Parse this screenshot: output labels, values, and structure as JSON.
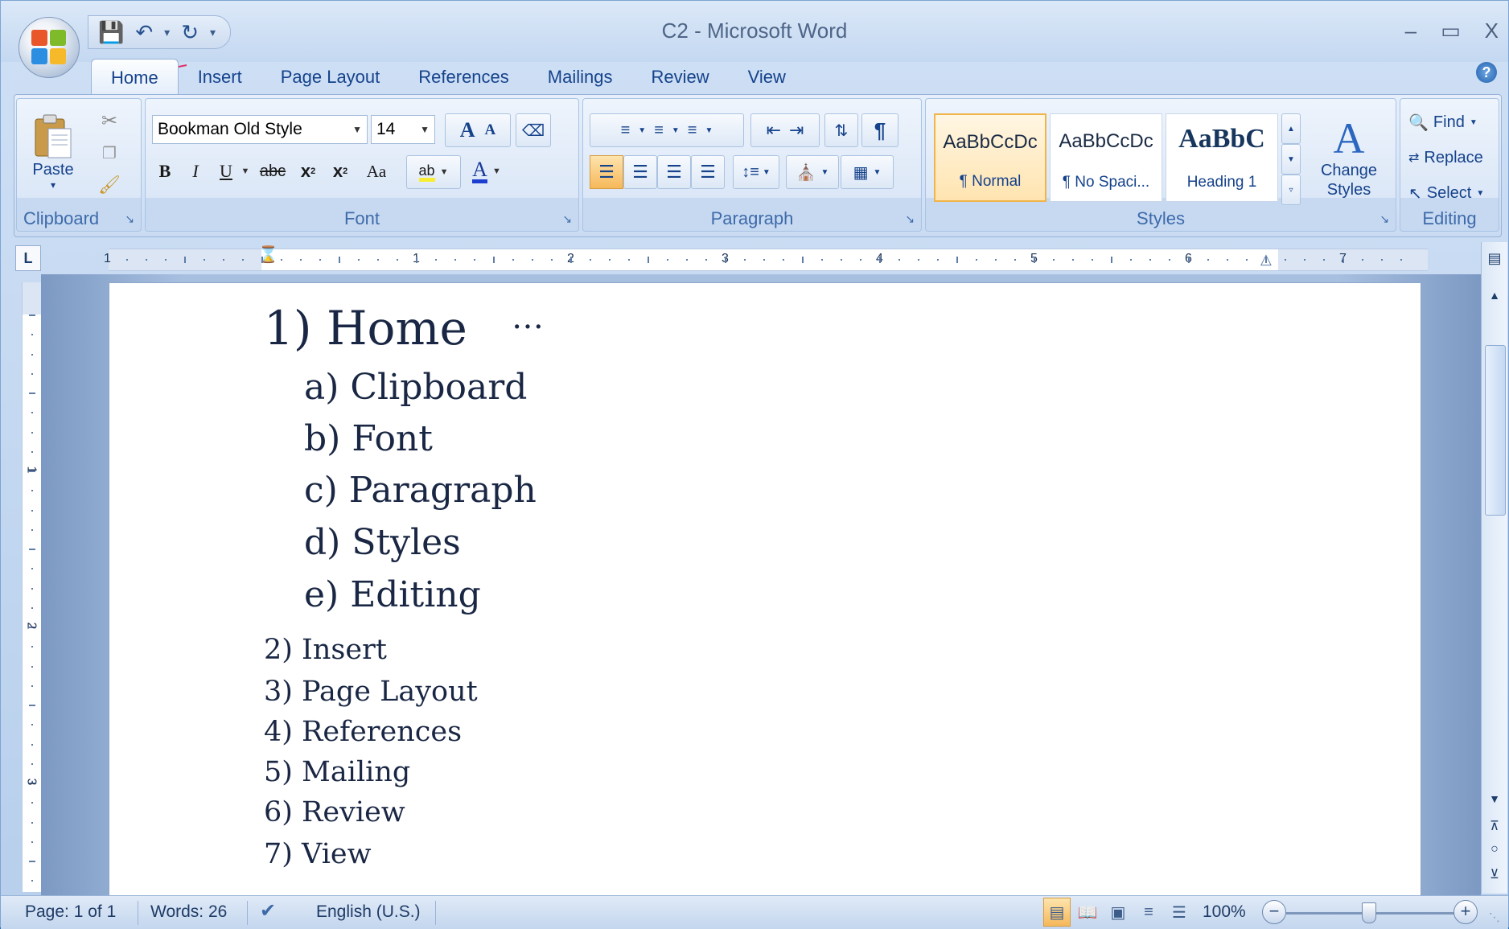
{
  "window": {
    "title": "C2 - Microsoft Word",
    "controls": [
      "–",
      "▭",
      "X"
    ]
  },
  "tabs": [
    "Home",
    "Insert",
    "Page Layout",
    "References",
    "Mailings",
    "Review",
    "View"
  ],
  "clipboard": {
    "paste_label": "Paste",
    "group_label": "Clipboard"
  },
  "font": {
    "name": "Bookman Old Style",
    "size": "14",
    "grow": "A",
    "shrink": "A",
    "bold": "B",
    "italic": "I",
    "underline": "U",
    "strike": "abc",
    "sub": "x",
    "sup": "x",
    "case": "Aa",
    "group_label": "Font"
  },
  "paragraph": {
    "group_label": "Paragraph",
    "pilcrow": "¶"
  },
  "styles": {
    "group_label": "Styles",
    "cards": [
      {
        "preview": "AaBbCcDc",
        "name": "¶ Normal"
      },
      {
        "preview": "AaBbCcDc",
        "name": "¶ No Spaci..."
      },
      {
        "preview": "AaBbC",
        "name": "Heading 1"
      }
    ],
    "change_label": "Change Styles"
  },
  "editing": {
    "find": "Find",
    "replace": "Replace",
    "select": "Select",
    "group_label": "Editing"
  },
  "ruler": {
    "numbers": [
      "1",
      "1",
      "2",
      "3",
      "4",
      "5",
      "6",
      "7"
    ],
    "vnumbers": [
      "1",
      "2",
      "3"
    ],
    "corner": "L"
  },
  "document": {
    "heading": "1)  Home",
    "ellipsis": "…",
    "subitems": [
      "a) Clipboard",
      "b) Font",
      "c) Paragraph",
      "d) Styles",
      "e) Editing"
    ],
    "items": [
      "2) Insert",
      "3) Page Layout",
      "4) References",
      "5) Mailing",
      "6) Review",
      "7) View"
    ]
  },
  "status": {
    "page": "Page: 1 of 1",
    "words": "Words: 26",
    "language": "English (U.S.)",
    "zoom": "100%"
  },
  "colors": {
    "accent": "#15428b",
    "annotation_arrow": "#e0306a",
    "active_button": "#f6b85a"
  }
}
